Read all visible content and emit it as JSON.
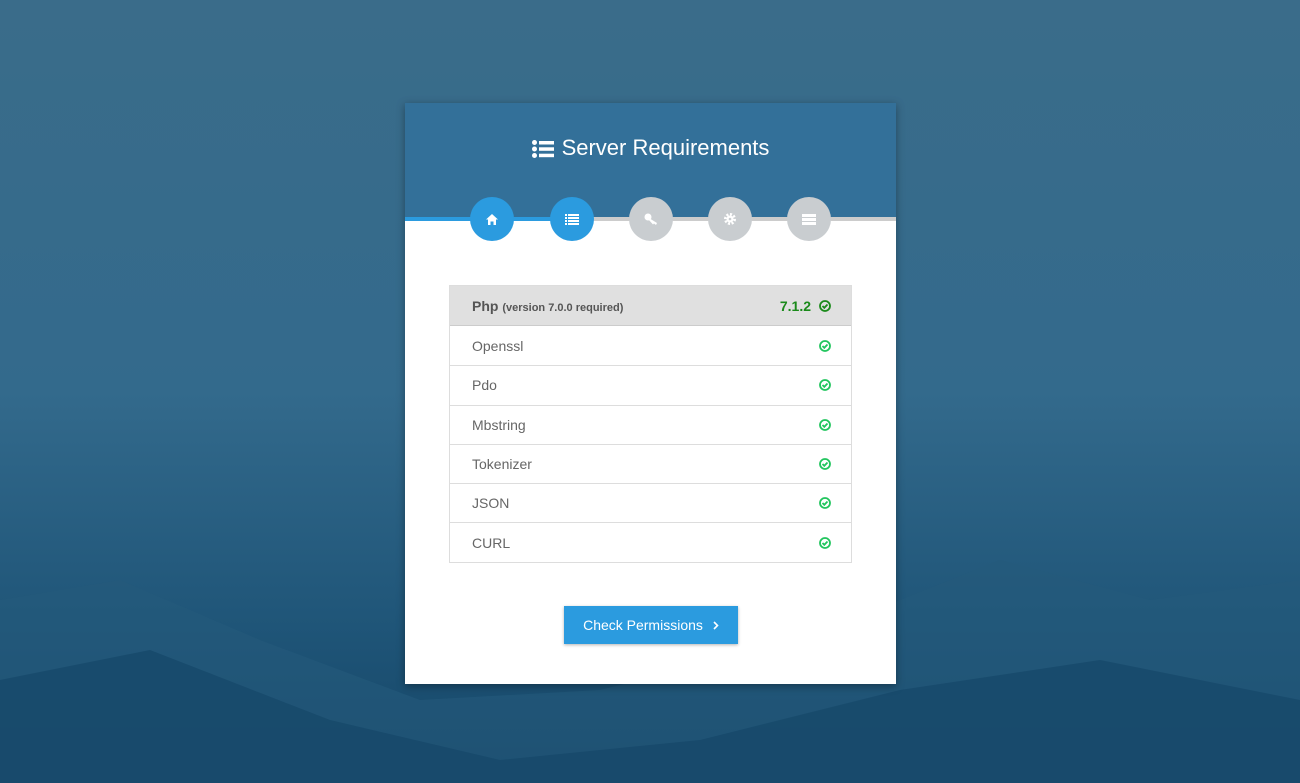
{
  "title": "Server Requirements",
  "steps": [
    {
      "icon": "home-icon",
      "active": true
    },
    {
      "icon": "list-icon",
      "active": true
    },
    {
      "icon": "key-icon",
      "active": false
    },
    {
      "icon": "gear-icon",
      "active": false
    },
    {
      "icon": "server-icon",
      "active": false
    }
  ],
  "php": {
    "label": "Php",
    "note": "(version 7.0.0 required)",
    "version": "7.1.2"
  },
  "requirements": [
    "Openssl",
    "Pdo",
    "Mbstring",
    "Tokenizer",
    "JSON",
    "CURL"
  ],
  "button": {
    "label": "Check Permissions"
  },
  "colors": {
    "accent": "#2b9bdf",
    "header": "#337099",
    "ok": "#22c55e",
    "php_ok": "#1a8a1a"
  }
}
